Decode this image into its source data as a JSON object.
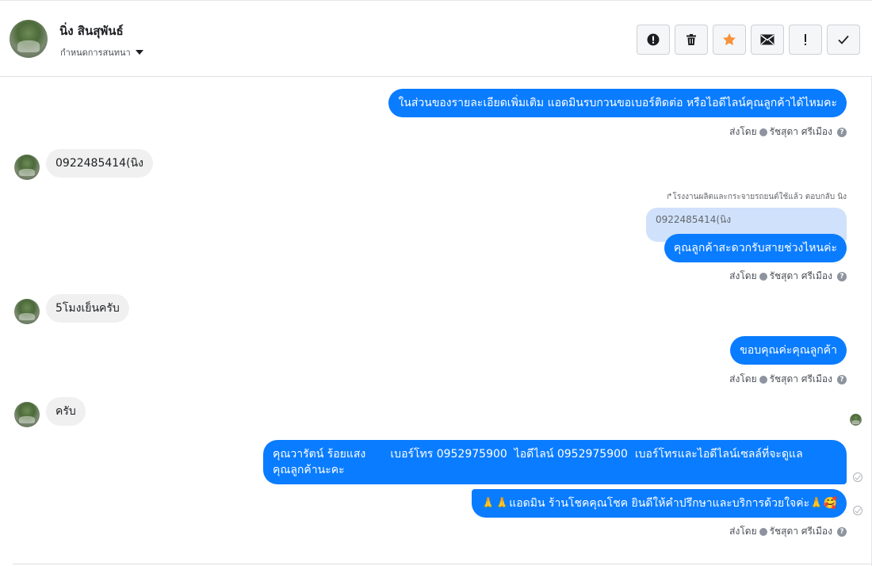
{
  "header": {
    "name": "นิ่ง สินสุพันธ์",
    "subtitle": "กำหนดการสนทนา",
    "toolbar": [
      {
        "icon": "alert-circle-icon"
      },
      {
        "icon": "trash-icon"
      },
      {
        "icon": "star-icon",
        "color": "#f7923b"
      },
      {
        "icon": "envelope-icon"
      },
      {
        "icon": "exclamation-icon"
      },
      {
        "icon": "checkmark-icon"
      }
    ]
  },
  "messages": {
    "m1": {
      "text": "ในส่วนของรายละเอียดเพิ่มเติม แอดมินรบกวนขอเบอร์ติดต่อ หรือไอดีไลน์คุณลูกค้าได้ไหมคะ",
      "sent_by_prefix": "ส่งโดย",
      "sent_by": "รัชสุดา ศรีเมือง"
    },
    "m2": {
      "text": "0922485414(นิง"
    },
    "m3": {
      "reply_meta": "โรงงานผลิตและกระจายรถยนต์ใช้แล้ว ตอบกลับ นิง",
      "quoted": "0922485414(นิง",
      "text": "คุณลูกค้าสะดวกรับสายช่วงไหนค่ะ",
      "sent_by_prefix": "ส่งโดย",
      "sent_by": "รัชสุดา ศรีเมือง"
    },
    "m4": {
      "text": "5โมงเย็นครับ"
    },
    "m5": {
      "text": "ขอบคุณค่ะคุณลูกค้า",
      "sent_by_prefix": "ส่งโดย",
      "sent_by": "รัชสุดา ศรีเมือง"
    },
    "m6": {
      "text": "ครับ"
    },
    "m7": {
      "line1": "คุณวารัตน์ ร้อยแสง       เบอร์โทร 0952975900  ไอดีไลน์ 0952975900  เบอร์โทรและไอดีไลน์เซลล์ที่จะดูแล",
      "line2": "คุณลูกค้านะคะ"
    },
    "m8": {
      "text": "🙏🙏แอดมิน ร้านโชคคุณโชค ยินดีให้คำปรึกษาและบริการด้วยใจค่ะ🙏🥰",
      "sent_by_prefix": "ส่งโดย",
      "sent_by": "รัชสุดา ศรีเมือง"
    }
  },
  "colors": {
    "outgoing": "#0a7cff",
    "incoming": "#f0f0f0",
    "star": "#f7923b"
  }
}
